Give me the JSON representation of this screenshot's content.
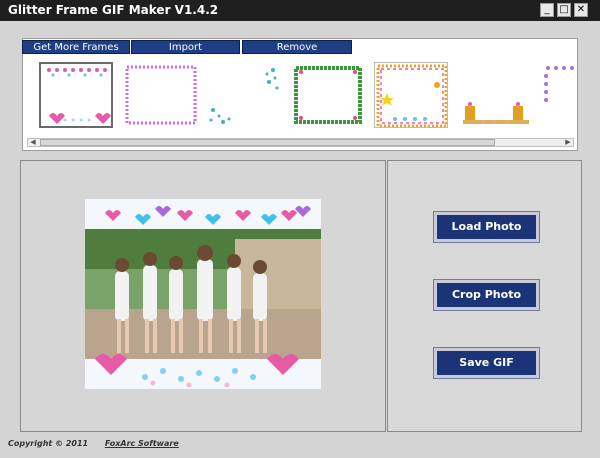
{
  "window": {
    "title": "Glitter Frame GIF Maker V1.4.2",
    "minimize_icon": "minimize-icon",
    "maximize_icon": "maximize-icon",
    "close_icon": "close-icon"
  },
  "tabs": [
    {
      "label": "Get More Frames"
    },
    {
      "label": "Import"
    },
    {
      "label": "Remove"
    }
  ],
  "frames": [
    {
      "name": "hearts-frame",
      "accent": "#e05aa0",
      "selected": true
    },
    {
      "name": "pink-dots-frame",
      "accent": "#d06ad8",
      "selected": false
    },
    {
      "name": "teal-corners-frame",
      "accent": "#3fb0c8",
      "selected": false
    },
    {
      "name": "green-flowers-frame",
      "accent": "#3a9a3a",
      "selected": false
    },
    {
      "name": "rainbow-stars-frame",
      "accent": "#f2a020",
      "selected": false
    },
    {
      "name": "candles-frame",
      "accent": "#e0a020",
      "selected": false
    },
    {
      "name": "purple-dots-frame",
      "accent": "#a870d0",
      "selected": false
    }
  ],
  "buttons": {
    "load_photo": "Load Photo",
    "crop_photo": "Crop Photo",
    "save_gif": "Save GIF"
  },
  "footer": {
    "copyright": "Copyright © 2011",
    "company": "FoxArc Software"
  },
  "colors": {
    "titlebar": "#1f1f1f",
    "tab": "#1e3e86",
    "button": "#1b3477"
  }
}
